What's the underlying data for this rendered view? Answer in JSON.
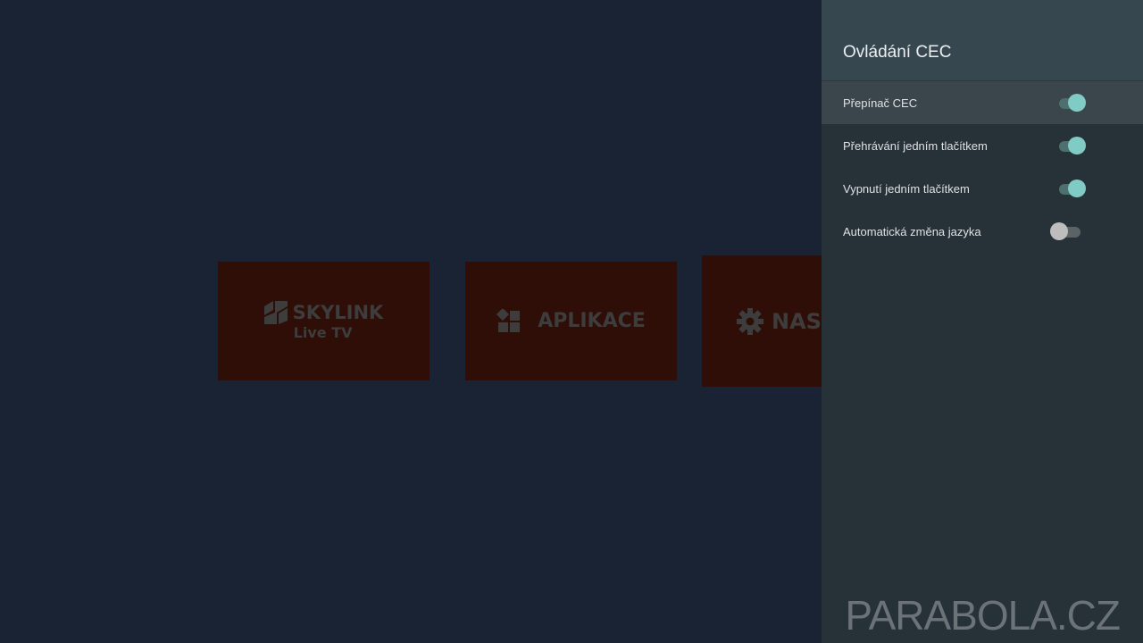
{
  "home": {
    "tiles": [
      {
        "name": "SKYLINK",
        "subtitle": "Live TV"
      },
      {
        "name": "APLIKACE"
      },
      {
        "name": "NAS"
      }
    ]
  },
  "panel": {
    "title": "Ovládání CEC",
    "items": [
      {
        "label": "Přepínač CEC",
        "state": "on",
        "focused": true
      },
      {
        "label": "Přehrávání jedním tlačítkem",
        "state": "on"
      },
      {
        "label": "Vypnutí jedním tlačítkem",
        "state": "on"
      },
      {
        "label": "Automatická změna jazyka",
        "state": "off"
      }
    ]
  },
  "watermark": "PARABOLA.CZ",
  "colors": {
    "background": "#192333",
    "panel": "#263238",
    "panel_header": "#37474f",
    "toggle_on": "#80cbc4",
    "toggle_off": "#bdbdbd",
    "tile": "#2f0e08"
  },
  "icons": {
    "skylink": "skylink-logo-icon",
    "apps": "apps-grid-icon",
    "settings": "gear-icon"
  }
}
